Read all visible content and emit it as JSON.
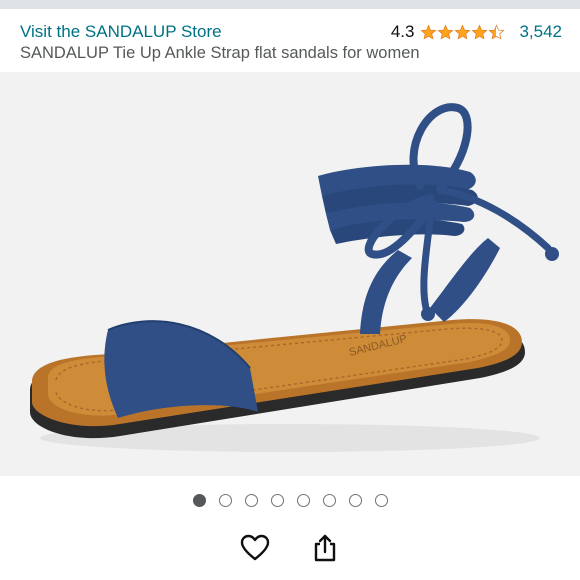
{
  "header": {
    "store_link": "Visit the SANDALUP Store",
    "rating_value": "4.3",
    "rating_stars": 4.3,
    "rating_count": "3,542"
  },
  "product": {
    "title": "SANDALUP Tie Up Ankle Strap flat sandals for women",
    "image": {
      "subject": "navy-blue-tie-up-flat-sandal",
      "insole_brand_mark": "SANDALUP",
      "colors": {
        "background": "#f2f2f2",
        "strap": "#2f4f86",
        "insole": "#c8842e",
        "sole": "#2a2a2a"
      }
    }
  },
  "carousel": {
    "total_images": 8,
    "active_index": 0
  },
  "actions": {
    "favorite_icon": "heart-icon",
    "share_icon": "share-icon"
  },
  "colors": {
    "link": "#007185",
    "star": "#ffa41c",
    "muted_text": "#565959"
  }
}
